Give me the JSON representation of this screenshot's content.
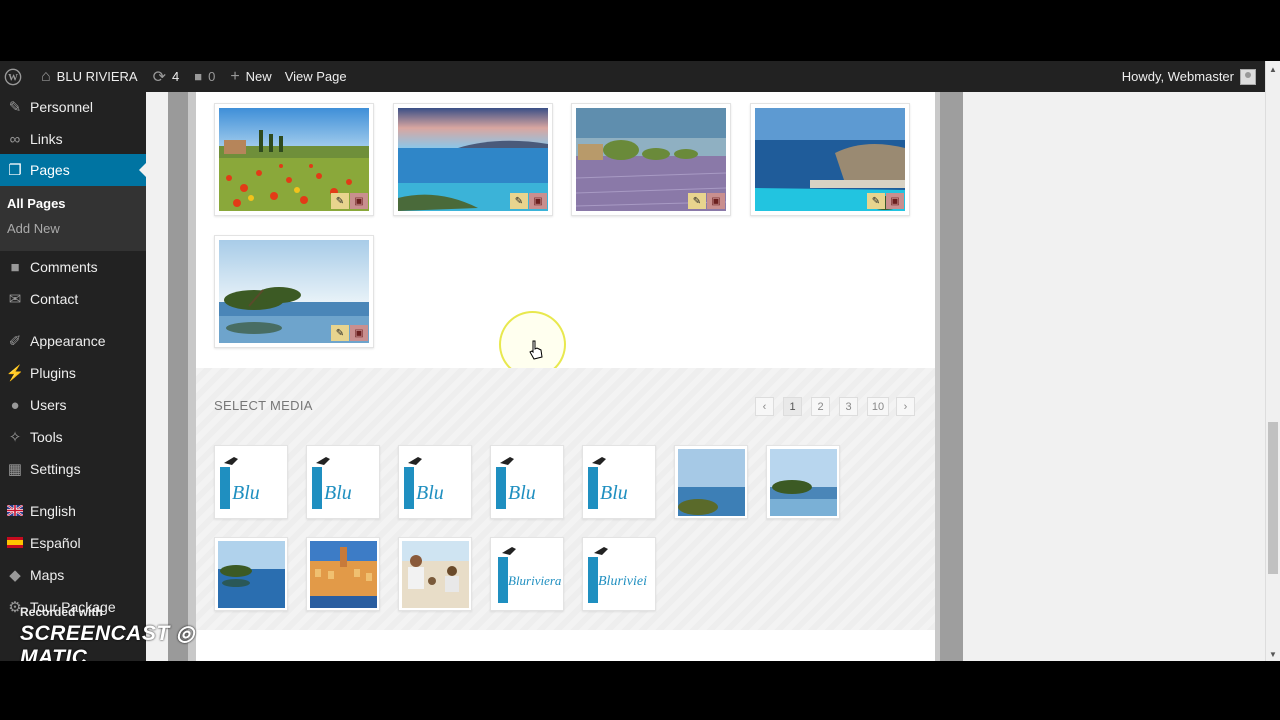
{
  "adminbar": {
    "site_name": "BLU RIVIERA",
    "updates_count": "4",
    "comments_count": "0",
    "new_label": "New",
    "view_page_label": "View Page",
    "howdy": "Howdy, Webmaster"
  },
  "sidebar": {
    "items": [
      {
        "label": "Personnel",
        "icon": "pin-icon"
      },
      {
        "label": "Links",
        "icon": "link-icon"
      },
      {
        "label": "Pages",
        "icon": "pages-icon"
      },
      {
        "label": "Comments",
        "icon": "comment-icon"
      },
      {
        "label": "Contact",
        "icon": "mail-icon"
      },
      {
        "label": "Appearance",
        "icon": "brush-icon"
      },
      {
        "label": "Plugins",
        "icon": "plug-icon"
      },
      {
        "label": "Users",
        "icon": "user-icon"
      },
      {
        "label": "Tools",
        "icon": "wrench-icon"
      },
      {
        "label": "Settings",
        "icon": "settings-icon"
      },
      {
        "label": "English",
        "icon": "uk-flag-icon"
      },
      {
        "label": "Español",
        "icon": "spain-flag-icon"
      },
      {
        "label": "Maps",
        "icon": "map-icon"
      },
      {
        "label": "Tour Package",
        "icon": "gear-icon"
      }
    ],
    "submenu": {
      "all_pages": "All Pages",
      "add_new": "Add New"
    }
  },
  "gallery": {
    "selected": [
      {
        "name": "poppy-field-tuscany"
      },
      {
        "name": "bay-at-dusk"
      },
      {
        "name": "lavender-field-coast"
      },
      {
        "name": "infinity-pool-rocks"
      },
      {
        "name": "pine-tree-sea"
      }
    ]
  },
  "select_media": {
    "title": "SELECT MEDIA",
    "pagination": [
      "1",
      "2",
      "3",
      "10"
    ],
    "current_page": "1",
    "items": [
      {
        "name": "blu-logo-1",
        "kind": "logo",
        "text": "Blu"
      },
      {
        "name": "blu-logo-2",
        "kind": "logo",
        "text": "Blu"
      },
      {
        "name": "blu-logo-3",
        "kind": "logo",
        "text": "Blu"
      },
      {
        "name": "blu-logo-4",
        "kind": "logo",
        "text": "Blu"
      },
      {
        "name": "blu-logo-5",
        "kind": "logo",
        "text": "Blu"
      },
      {
        "name": "sea-view",
        "kind": "photo"
      },
      {
        "name": "pine-tree-sea-thumb",
        "kind": "photo"
      },
      {
        "name": "pool-reflection",
        "kind": "photo"
      },
      {
        "name": "menton-town",
        "kind": "photo"
      },
      {
        "name": "family-beach",
        "kind": "photo"
      },
      {
        "name": "bluriviera-logo-1",
        "kind": "logo",
        "text": "Bluriviera"
      },
      {
        "name": "bluriviera-logo-2",
        "kind": "logo",
        "text": "Bluriviei"
      }
    ]
  },
  "watermark": {
    "small": "Recorded with",
    "brand": "SCREENCAST ◎ MATIC"
  },
  "colors": {
    "accent": "#0074a2",
    "adminbar": "#222222",
    "edit_btn": "#e8d48e",
    "delete_btn": "#c98f8f"
  }
}
